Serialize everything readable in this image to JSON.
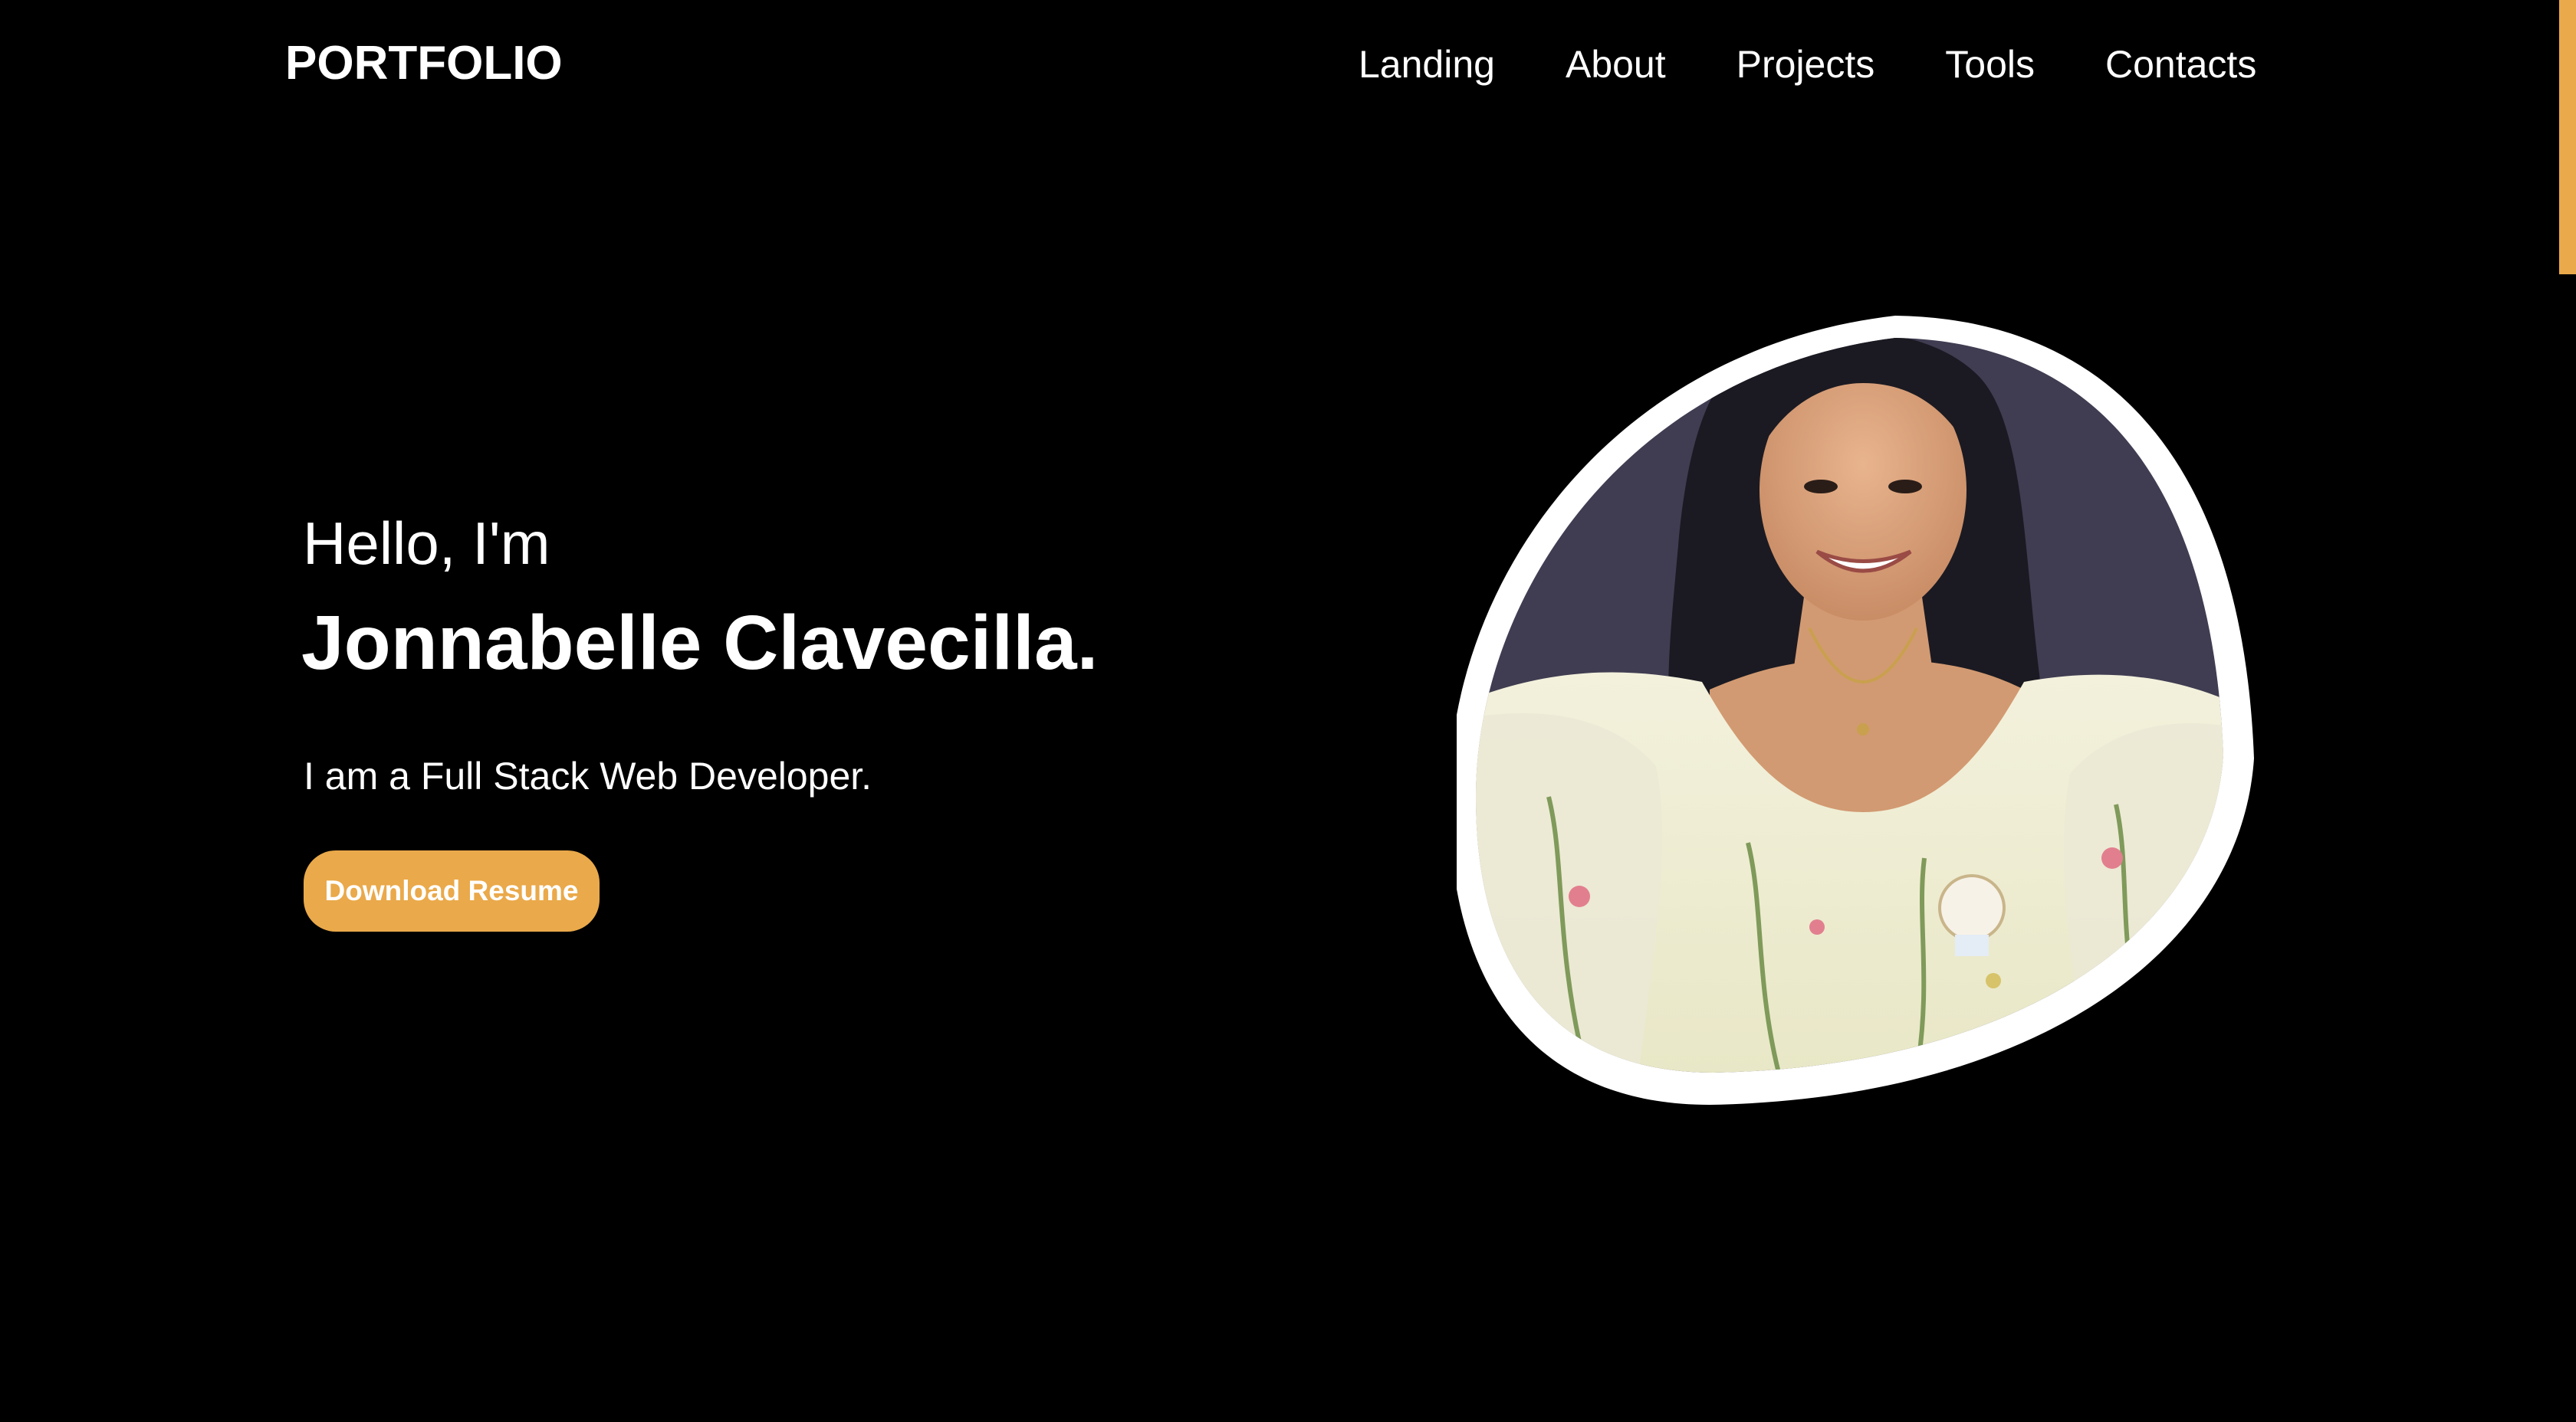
{
  "header": {
    "logo": "PORTFOLIO",
    "nav": [
      {
        "label": "Landing"
      },
      {
        "label": "About"
      },
      {
        "label": "Projects"
      },
      {
        "label": "Tools"
      },
      {
        "label": "Contacts"
      }
    ]
  },
  "hero": {
    "greeting": "Hello, I'm",
    "name": "Jonnabelle Clavecilla.",
    "role": "I am a Full Stack Web Developer.",
    "cta_label": "Download Resume"
  },
  "colors": {
    "background": "#000000",
    "accent": "#eaa94a",
    "text": "#ffffff",
    "photo_backdrop": "#403d52"
  },
  "portrait": {
    "icon": "profile-photo"
  }
}
